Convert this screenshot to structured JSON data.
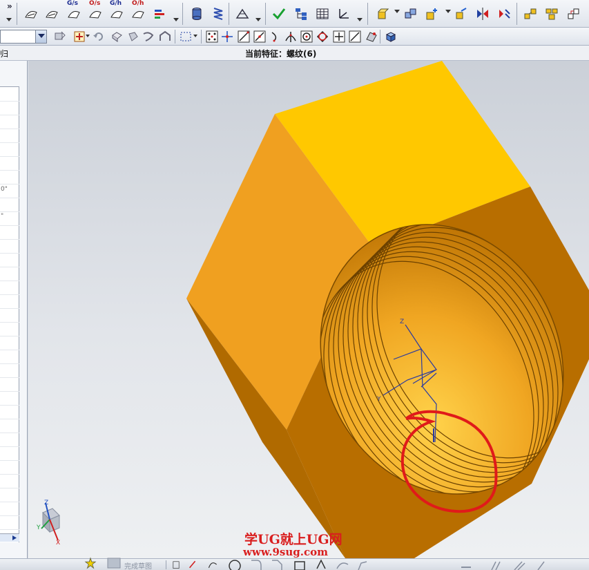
{
  "status": {
    "left_text": "归",
    "current_feature": "当前特征：螺纹(6)"
  },
  "left_panel": {
    "fragments": [
      "0\"",
      "\""
    ]
  },
  "toolbar_top": {
    "overflow_label": "»",
    "tool_labels": [
      "G/s",
      "O/s",
      "G/h",
      "O/h"
    ]
  },
  "bottom_bar": {
    "label": "完成草图"
  },
  "axes": {
    "z": "Z",
    "y": "Y",
    "x": "X"
  },
  "watermark": {
    "line1": "学UG就上UG网",
    "line2": "www.9sug.com"
  },
  "colors": {
    "nut_top": "#ffc800",
    "nut_left": "#f0a020",
    "nut_right": "#b86e00",
    "annotation": "#e01a1a"
  }
}
